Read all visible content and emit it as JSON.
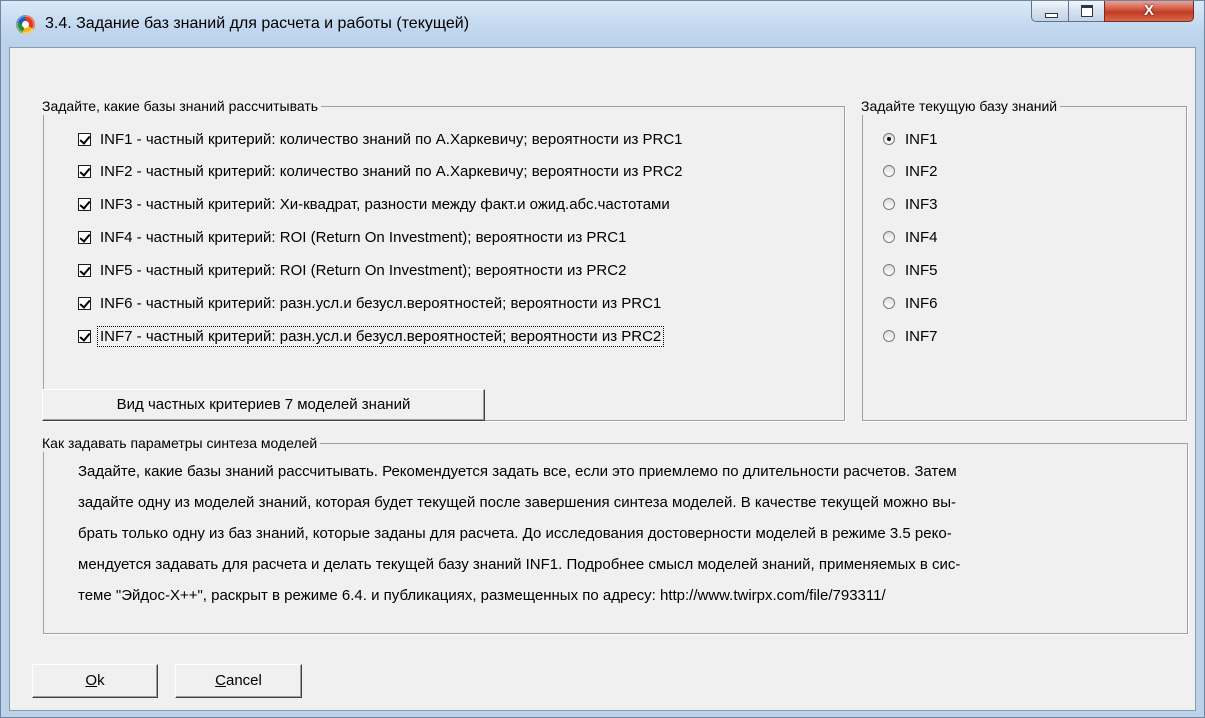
{
  "window": {
    "title": "3.4. Задание баз знаний для расчета и работы (текущей)",
    "close_glyph": "X"
  },
  "calc_group": {
    "title": "Задайте, какие базы знаний рассчитывать",
    "items": [
      {
        "label": "INF1 - частный критерий: количество знаний по А.Харкевичу; вероятности из PRC1",
        "checked": true
      },
      {
        "label": "INF2 - частный критерий: количество знаний по А.Харкевичу; вероятности из PRC2",
        "checked": true
      },
      {
        "label": "INF3 - частный критерий: Хи-квадрат, разности между факт.и ожид.абс.частотами",
        "checked": true
      },
      {
        "label": "INF4 - частный критерий: ROI (Return On Investment); вероятности из PRC1",
        "checked": true
      },
      {
        "label": "INF5 - частный критерий: ROI (Return On Investment); вероятности из PRC2",
        "checked": true
      },
      {
        "label": "INF6 - частный критерий: разн.усл.и безусл.вероятностей; вероятности из PRC1",
        "checked": true
      },
      {
        "label": "INF7 - частный критерий: разн.усл.и безусл.вероятностей; вероятности из PRC2",
        "checked": true
      }
    ]
  },
  "current_group": {
    "title": "Задайте текущую базу знаний",
    "items": [
      {
        "label": "INF1",
        "selected": true
      },
      {
        "label": "INF2",
        "selected": false
      },
      {
        "label": "INF3",
        "selected": false
      },
      {
        "label": "INF4",
        "selected": false
      },
      {
        "label": "INF5",
        "selected": false
      },
      {
        "label": "INF6",
        "selected": false
      },
      {
        "label": "INF7",
        "selected": false
      }
    ]
  },
  "view_button": {
    "label": "Вид частных критериев 7 моделей знаний"
  },
  "help_group": {
    "title": "Как задавать параметры синтеза моделей",
    "lines": [
      "Задайте, какие базы знаний рассчитывать. Рекомендуется задать все, если это приемлемо по длительности расчетов. Затем",
      "задайте одну из моделей знаний, которая будет текущей после завершения синтеза моделей.  В качестве текущей можно вы-",
      "брать только одну из баз знаний, которые заданы для расчета. До исследования достоверности моделей в режиме 3.5 реко-",
      "мендуется задавать для расчета и делать текущей базу знаний INF1.  Подробнее смысл моделей знаний, применяемых в сис-",
      "теме \"Эйдос-Х++\", раскрыт в режиме 6.4. и публикациях, размещенных по адресу: http://www.twirpx.com/file/793311/"
    ]
  },
  "ok_button": {
    "accel": "O",
    "rest": "k"
  },
  "cancel_button": {
    "accel": "C",
    "rest": "ancel"
  }
}
